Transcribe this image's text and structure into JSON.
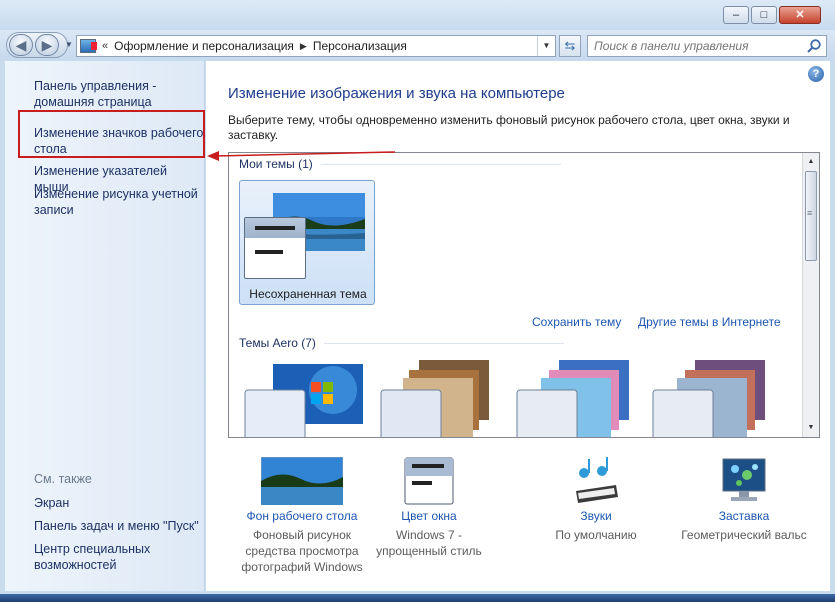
{
  "address": {
    "prefix": "«",
    "segments": [
      "Оформление и персонализация",
      "Персонализация"
    ]
  },
  "search": {
    "placeholder": "Поиск в панели управления"
  },
  "window_buttons": {
    "minimize": "–",
    "maximize": "□",
    "close": "✕"
  },
  "sidebar": {
    "links": [
      "Панель управления - домашняя страница",
      "Изменение значков рабочего стола",
      "Изменение указателей мыши",
      "Изменение рисунка учетной записи"
    ],
    "see_also": "См. также",
    "see_links": [
      "Экран",
      "Панель задач и меню \"Пуск\"",
      "Центр специальных возможностей"
    ]
  },
  "main": {
    "help": "?",
    "title": "Изменение изображения и звука на компьютере",
    "description": "Выберите тему, чтобы одновременно изменить фоновый рисунок рабочего стола, цвет окна, звуки и заставку.",
    "my_themes": "Мои темы (1)",
    "unsaved_theme": "Несохраненная тема",
    "save_theme": "Сохранить тему",
    "other_themes": "Другие темы в Интернете",
    "aero_themes": "Темы Aero (7)"
  },
  "bottom": [
    {
      "title": "Фон рабочего стола",
      "sub": "Фоновый рисунок средства просмотра фотографий Windows",
      "icon": "landscape-icon"
    },
    {
      "title": "Цвет окна",
      "sub": "Windows 7 - упрощенный стиль",
      "icon": "window-color-icon"
    },
    {
      "title": "Звуки",
      "sub": "По умолчанию",
      "icon": "sounds-icon"
    },
    {
      "title": "Заставка",
      "sub": "Геометрический вальс",
      "icon": "screensaver-icon"
    }
  ],
  "colors": {
    "link": "#1c56b0",
    "title": "#1e3c8c",
    "highlight": "#c91c1c"
  }
}
